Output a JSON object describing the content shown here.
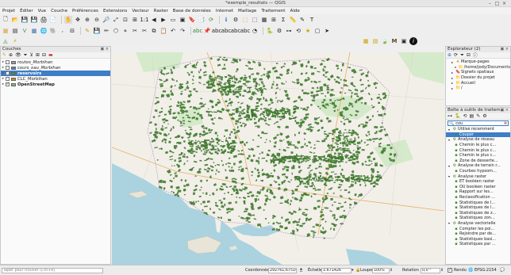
{
  "window": {
    "title": "*exemple_resultats — QGIS"
  },
  "menus": [
    "Projet",
    "Éditer",
    "Vue",
    "Couche",
    "Préférences",
    "Extensions",
    "Vecteur",
    "Raster",
    "Base de données",
    "Internet",
    "Maillage",
    "Traitement",
    "Aide"
  ],
  "layers_panel": {
    "title": "Couches",
    "layers": [
      {
        "name": "routes_Morbihan",
        "checked": false,
        "style": "italic",
        "swatch": "#999999"
      },
      {
        "name": "cours_eau_Morbihan",
        "checked": false,
        "style": "italic",
        "swatch": "#4a84c8"
      },
      {
        "name": "reservoirs",
        "checked": true,
        "style": "bold",
        "swatch": "#4c8a3a",
        "selected": true
      },
      {
        "name": "CLC_Morbihan",
        "checked": false,
        "style": "normal",
        "swatch": "#c08a40"
      },
      {
        "name": "OpenStreetMap",
        "checked": true,
        "style": "bold",
        "swatch": "#7fb87a"
      }
    ],
    "selected_color": "#3d7ec7"
  },
  "browser_panel": {
    "title": "Explorateur (2)",
    "items": [
      {
        "label": "Marque-pages",
        "indent": 1,
        "icon": "star-icon"
      },
      {
        "label": "/home/jody/Documents",
        "indent": 2,
        "icon": "folder-icon"
      },
      {
        "label": "Signets spatiaux",
        "indent": 1,
        "icon": "bookmark-icon"
      },
      {
        "label": "Dossier du projet",
        "indent": 1,
        "icon": "folder-icon"
      },
      {
        "label": "Accueil",
        "indent": 1,
        "icon": "folder-icon"
      },
      {
        "label": "/",
        "indent": 1,
        "icon": "folder-icon"
      }
    ]
  },
  "toolbox_panel": {
    "title": "Boîte à outils de traitem...",
    "search_value": "cou",
    "items": [
      {
        "label": "Utilisé récemment",
        "indent": 0,
        "type": "group"
      },
      {
        "label": "Couper",
        "indent": 1,
        "type": "algo",
        "selected": true
      },
      {
        "label": "Analyse de réseau",
        "indent": 0,
        "type": "group"
      },
      {
        "label": "Chemin le plus c...",
        "indent": 1,
        "type": "algo"
      },
      {
        "label": "Chemin le plus c...",
        "indent": 1,
        "type": "algo"
      },
      {
        "label": "Chemin le plus c...",
        "indent": 1,
        "type": "algo"
      },
      {
        "label": "Zone de desserte...",
        "indent": 1,
        "type": "algo"
      },
      {
        "label": "Analyse de terrain r...",
        "indent": 0,
        "type": "group"
      },
      {
        "label": "Courbes hypsom...",
        "indent": 1,
        "type": "algo"
      },
      {
        "label": "Analyse raster",
        "indent": 0,
        "type": "group"
      },
      {
        "label": "ET booléen raster",
        "indent": 1,
        "type": "algo"
      },
      {
        "label": "OU booléen raster",
        "indent": 1,
        "type": "algo"
      },
      {
        "label": "Rapport sur les...",
        "indent": 1,
        "type": "algo"
      },
      {
        "label": "Reclassification ...",
        "indent": 1,
        "type": "algo"
      },
      {
        "label": "Statistiques de l...",
        "indent": 1,
        "type": "algo"
      },
      {
        "label": "Statistiques de l...",
        "indent": 1,
        "type": "algo"
      },
      {
        "label": "Statistiques de z...",
        "indent": 1,
        "type": "algo"
      },
      {
        "label": "Statistiques zon...",
        "indent": 1,
        "type": "algo"
      },
      {
        "label": "Analyse vectorielle",
        "indent": 0,
        "type": "group"
      },
      {
        "label": "Compter les poi...",
        "indent": 1,
        "type": "algo"
      },
      {
        "label": "Rejoindre par de...",
        "indent": 1,
        "type": "algo"
      },
      {
        "label": "Statistiques basi...",
        "indent": 1,
        "type": "algo"
      },
      {
        "label": "Statistiques par ...",
        "indent": 1,
        "type": "algo"
      }
    ],
    "selected_color": "#3d7ec7"
  },
  "status": {
    "search_placeholder": "Taper pour trouver (Ctrl+K)",
    "coord_label": "Coordonnée",
    "coord_value": "292761,6751421",
    "scale_label": "Échelle",
    "scale_value": "1:671426",
    "zoom_label": "Loupe",
    "zoom_value": "100%",
    "rotation_label": "Rotation",
    "rotation_value": "0,0 °",
    "render_label": "Rendu",
    "crs_label": "EPSG:2154"
  },
  "colors": {
    "accent": "#3d7ec7",
    "reservoir_fill": "#4c8a3a",
    "sea": "#aad3df",
    "land": "#f2efe9",
    "forest": "#cde8c2"
  }
}
